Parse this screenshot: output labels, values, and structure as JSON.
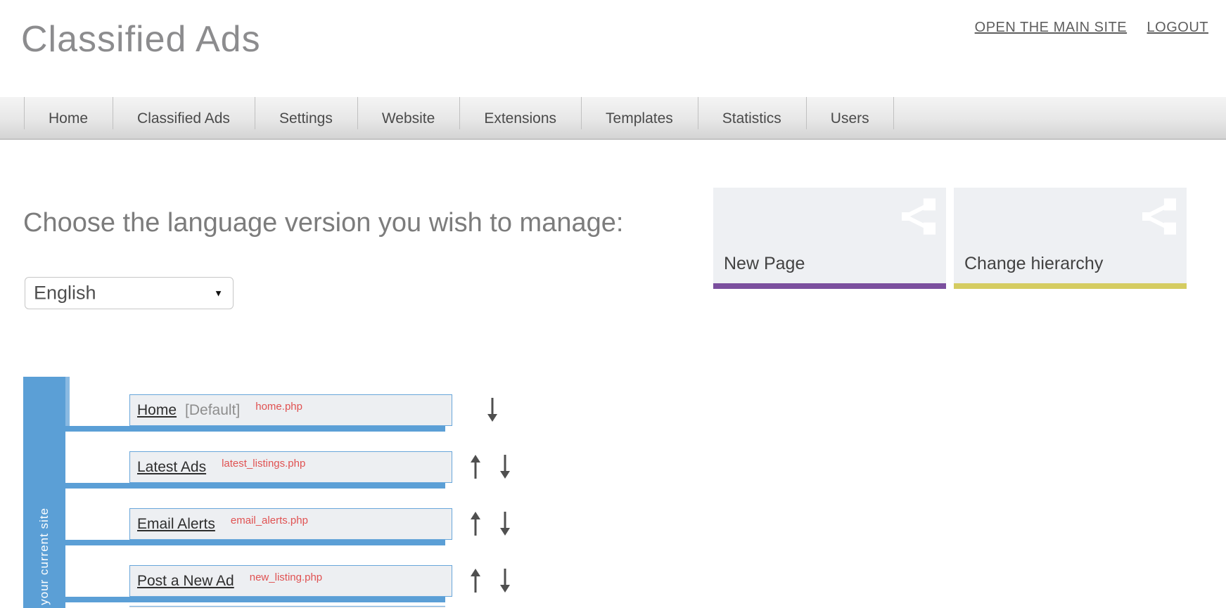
{
  "header": {
    "logo": "Classified Ads",
    "links": [
      {
        "label": "OPEN THE MAIN SITE"
      },
      {
        "label": "LOGOUT"
      }
    ]
  },
  "nav": {
    "items": [
      {
        "label": "Home"
      },
      {
        "label": "Classified Ads"
      },
      {
        "label": "Settings"
      },
      {
        "label": "Website"
      },
      {
        "label": "Extensions"
      },
      {
        "label": "Templates"
      },
      {
        "label": "Statistics"
      },
      {
        "label": "Users"
      }
    ]
  },
  "main": {
    "heading": "Choose the language version you wish to manage:",
    "language_select": {
      "value": "English",
      "dropdown_icon": "▼"
    },
    "action_cards": [
      {
        "label": "New Page",
        "icon": "sitemap-icon",
        "accent_color": "#7b4f9e"
      },
      {
        "label": "Change hierarchy",
        "icon": "sitemap-icon",
        "accent_color": "#d5cc61"
      }
    ],
    "site_tree": {
      "sidebar_label": "your current site",
      "pages": [
        {
          "title": "Home",
          "badge": "[Default]",
          "file": "home.php",
          "can_move_up": false,
          "can_move_down": true
        },
        {
          "title": "Latest Ads",
          "badge": "",
          "file": "latest_listings.php",
          "can_move_up": true,
          "can_move_down": true
        },
        {
          "title": "Email Alerts",
          "badge": "",
          "file": "email_alerts.php",
          "can_move_up": true,
          "can_move_down": true
        },
        {
          "title": "Post a New Ad",
          "badge": "",
          "file": "new_listing.php",
          "can_move_up": true,
          "can_move_down": true
        }
      ]
    }
  },
  "colors": {
    "tree_blue": "#5b9fd6",
    "tree_box_border": "#68a6da",
    "tree_box_bg": "#edeff2",
    "card_bg": "#eef0f3",
    "file_red": "#e05252",
    "nav_text": "#4a4a4a",
    "arrow_gray": "#4f4f4f"
  }
}
